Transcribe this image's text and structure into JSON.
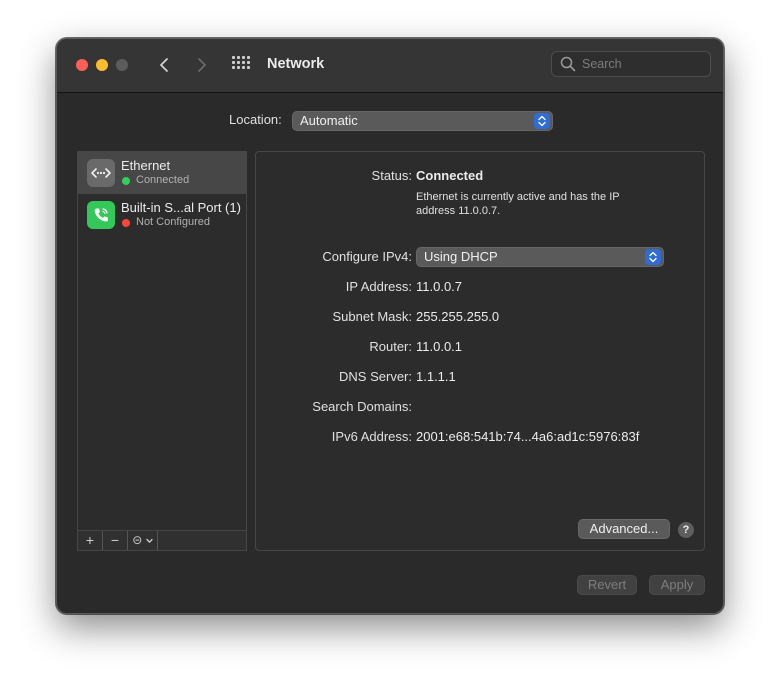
{
  "window": {
    "title": "Network"
  },
  "search": {
    "placeholder": "Search"
  },
  "location": {
    "label": "Location:",
    "value": "Automatic"
  },
  "services": [
    {
      "name": "Ethernet",
      "status": "Connected",
      "status_color": "#30d158",
      "icon": "ethernet-icon"
    },
    {
      "name": "Built-in S...al Port (1)",
      "status": "Not Configured",
      "status_color": "#ff453a",
      "icon": "phone-icon"
    }
  ],
  "sidebar_controls": {
    "add": "+",
    "remove": "−",
    "action": "⊝"
  },
  "detail": {
    "status_label": "Status:",
    "status_value": "Connected",
    "status_desc": "Ethernet is currently active and has the IP address 11.0.0.7.",
    "configure_label": "Configure IPv4:",
    "configure_value": "Using DHCP",
    "fields": [
      {
        "label": "IP Address:",
        "value": "11.0.0.7"
      },
      {
        "label": "Subnet Mask:",
        "value": "255.255.255.0"
      },
      {
        "label": "Router:",
        "value": "11.0.0.1"
      },
      {
        "label": "DNS Server:",
        "value": "1.1.1.1"
      },
      {
        "label": "Search Domains:",
        "value": ""
      },
      {
        "label": "IPv6 Address:",
        "value": "2001:e68:541b:74...4a6:ad1c:5976:83f"
      }
    ],
    "advanced_label": "Advanced...",
    "help_label": "?"
  },
  "footer": {
    "revert_label": "Revert",
    "apply_label": "Apply"
  },
  "colors": {
    "accent": "#2f6cd8",
    "connected": "#30d158",
    "not_configured": "#ff453a"
  }
}
